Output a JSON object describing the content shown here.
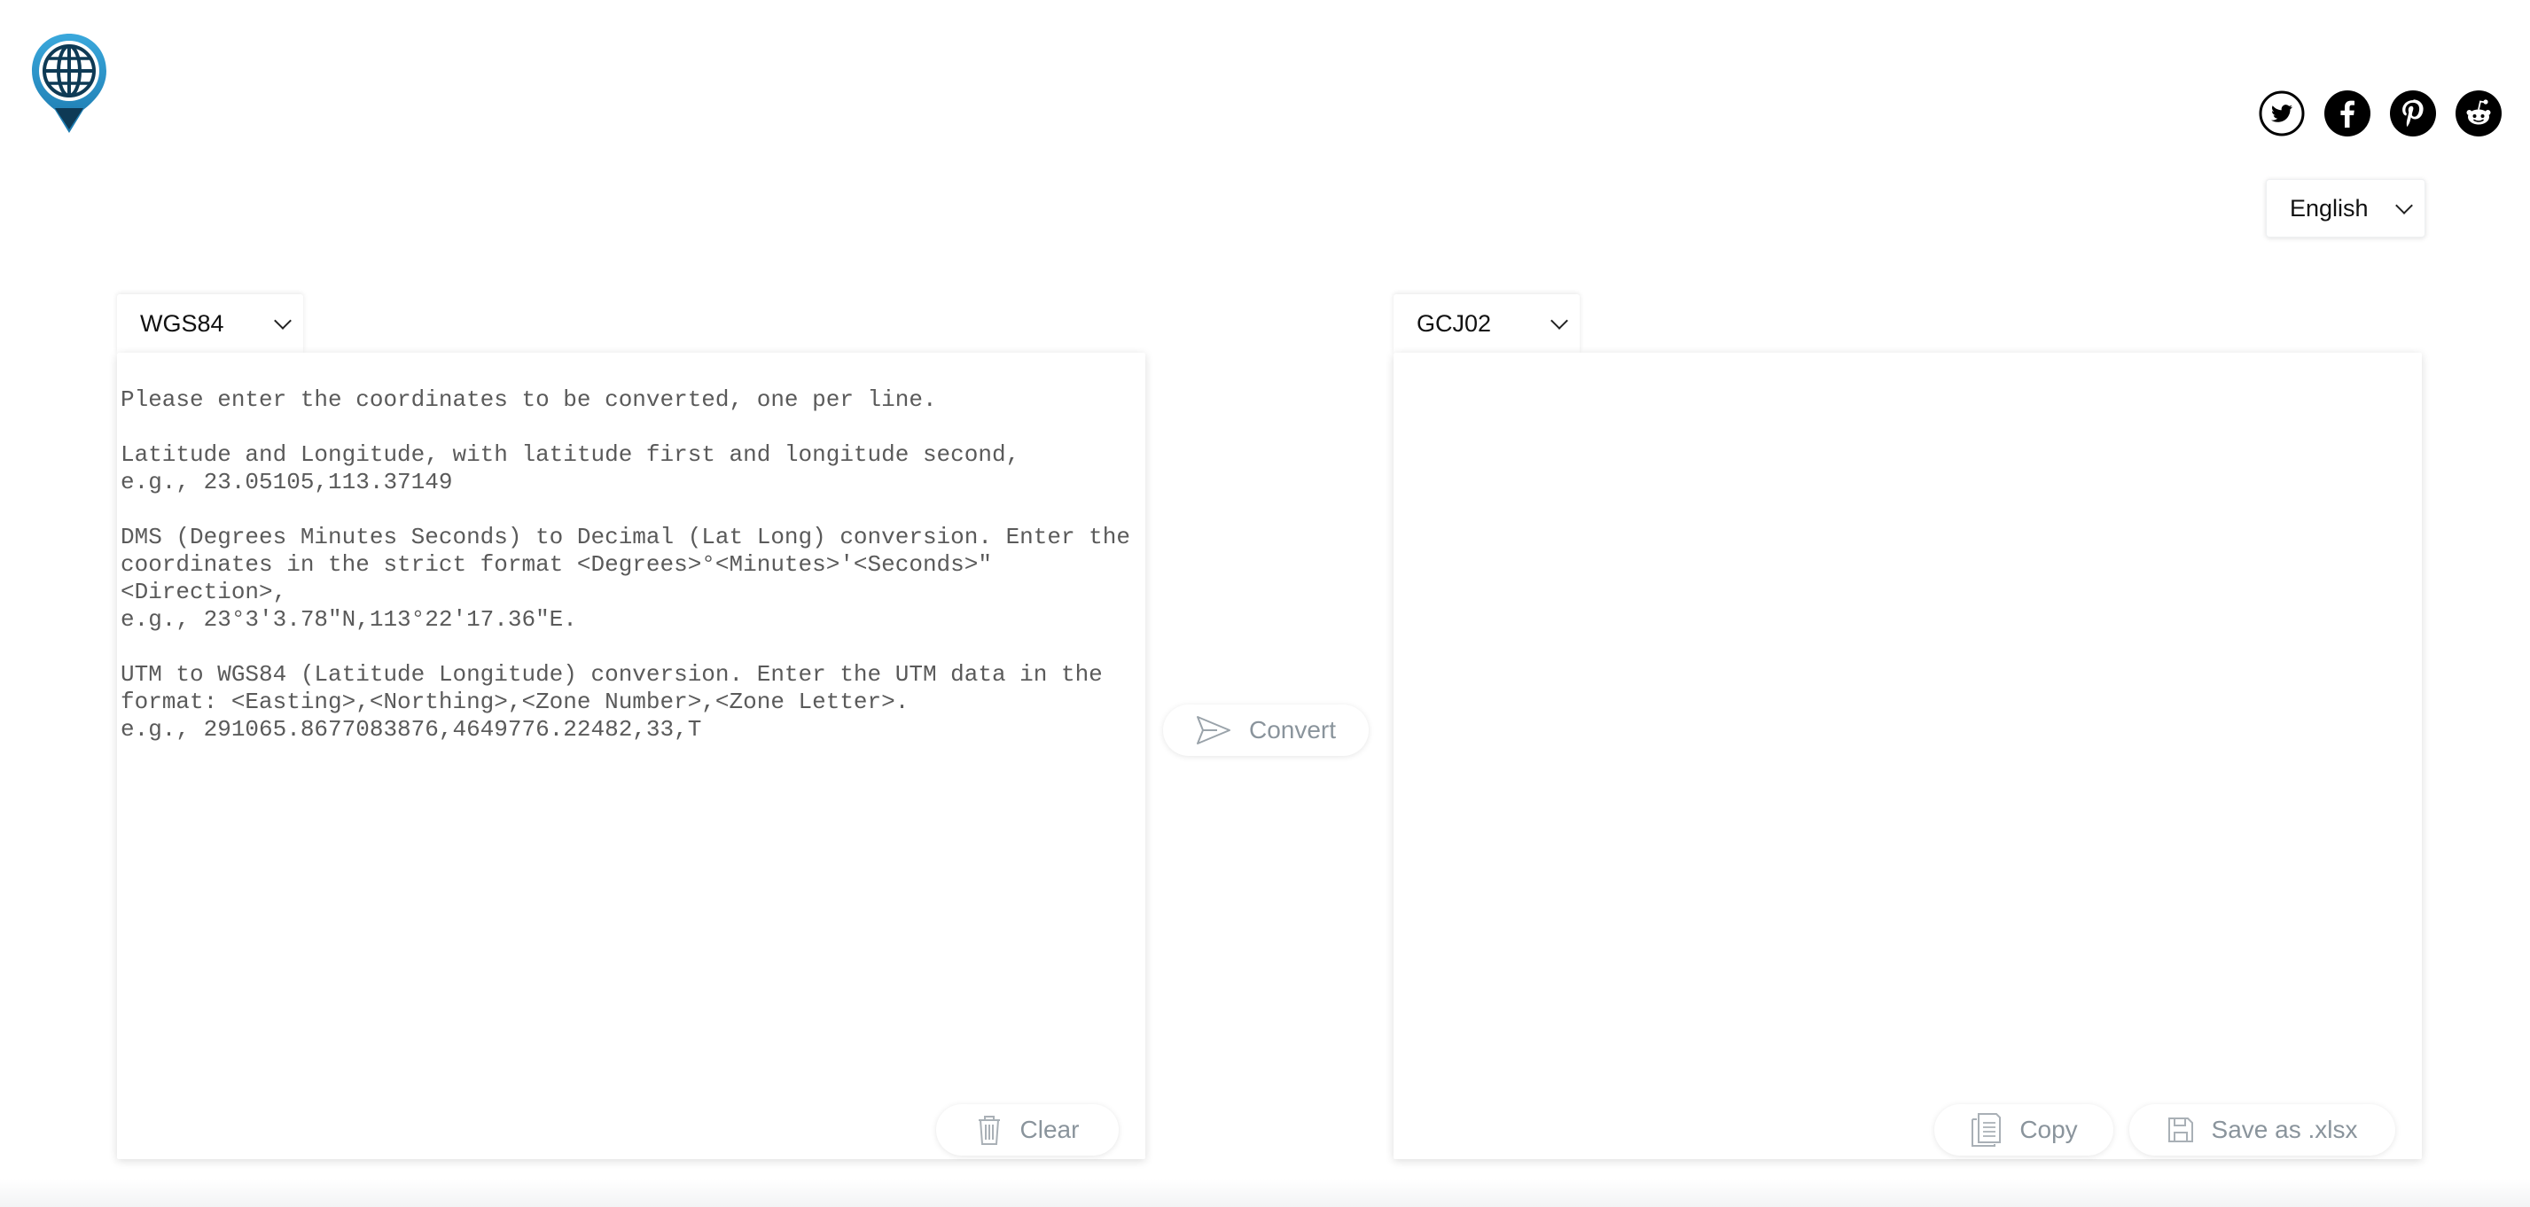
{
  "header": {
    "logo_icon": "globe-location-pin-icon",
    "social": [
      {
        "name": "twitter",
        "icon": "twitter-icon"
      },
      {
        "name": "facebook",
        "icon": "facebook-icon"
      },
      {
        "name": "pinterest",
        "icon": "pinterest-icon"
      },
      {
        "name": "reddit",
        "icon": "reddit-icon"
      }
    ],
    "language": {
      "selected": "English"
    }
  },
  "input_panel": {
    "crs_selected": "WGS84",
    "placeholder": "Please enter the coordinates to be converted, one per line.\n\nLatitude and Longitude, with latitude first and longitude second,\ne.g., 23.05105,113.37149\n\nDMS (Degrees Minutes Seconds) to Decimal (Lat Long) conversion. Enter the coordinates in the strict format <Degrees>°<Minutes>'<Seconds>\"<Direction>,\ne.g., 23°3'3.78\"N,113°22'17.36\"E.\n\nUTM to WGS84 (Latitude Longitude) conversion. Enter the UTM data in the format: <Easting>,<Northing>,<Zone Number>,<Zone Letter>.\ne.g., 291065.8677083876,4649776.22482,33,T",
    "value": "",
    "clear_label": "Clear"
  },
  "convert": {
    "label": "Convert"
  },
  "output_panel": {
    "crs_selected": "GCJ02",
    "value": "",
    "copy_label": "Copy",
    "save_label": "Save as .xlsx"
  },
  "colors": {
    "logo_blue": "#2a8fc7",
    "logo_dark": "#0e3a55",
    "button_text": "#8a949c"
  }
}
